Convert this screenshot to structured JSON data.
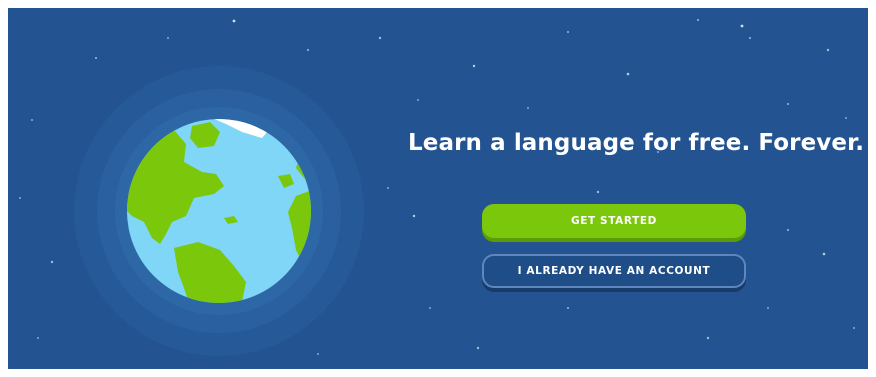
{
  "hero": {
    "headline": "Learn a language for free. Forever.",
    "get_started_label": "GET STARTED",
    "have_account_label": "I ALREADY HAVE AN ACCOUNT"
  },
  "colors": {
    "background": "#235390",
    "primary_button": "#7ac70c",
    "secondary_button": "#1f4d87",
    "globe_ocean": "#7fd6f6",
    "globe_land": "#7ac70c"
  },
  "icons": {
    "globe": "globe-illustration"
  }
}
